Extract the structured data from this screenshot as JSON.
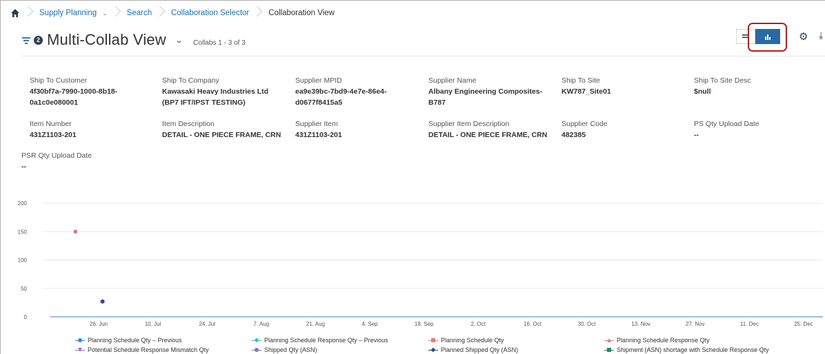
{
  "breadcrumb": {
    "items": [
      {
        "label": "Supply Planning",
        "link": true
      },
      {
        "label": "Search",
        "link": true
      },
      {
        "label": "Collaboration Selector",
        "link": true
      },
      {
        "label": "Collaboration View",
        "link": false
      }
    ]
  },
  "header": {
    "filter_badge": "2",
    "title": "Multi-Collab View",
    "collabs_count": "Collabs 1 - 3 of 3"
  },
  "details": [
    {
      "label": "Ship To Customer",
      "value": "4f30bf7a-7990-1000-8b18-0a1c0e080001"
    },
    {
      "label": "Ship To Company",
      "value": "Kawasaki Heavy Industries Ltd (BP7 IFT/IPST TESTING)"
    },
    {
      "label": "Supplier MPID",
      "value": "ea9e39bc-7bd9-4e7e-86e4-d0677f8415a5"
    },
    {
      "label": "Supplier Name",
      "value": "Albany Engineering Composites-B787"
    },
    {
      "label": "Ship To Site",
      "value": "KW787_Site01"
    },
    {
      "label": "Ship To Site Desc",
      "value": "$null"
    },
    {
      "label": "Item Number",
      "value": "431Z1103-201"
    },
    {
      "label": "Item Description",
      "value": "DETAIL - ONE PIECE FRAME, CRN"
    },
    {
      "label": "Supplier Item",
      "value": "431Z1103-201"
    },
    {
      "label": "Supplier Item Description",
      "value": "DETAIL - ONE PIECE FRAME, CRN"
    },
    {
      "label": "Supplier Code",
      "value": "482385"
    },
    {
      "label": "PS Qty Upload Date",
      "value": "--"
    },
    {
      "label": "PSR Qty Upload Date",
      "value": "--"
    }
  ],
  "chart_data": {
    "type": "scatter",
    "y_ticks": [
      "0",
      "50",
      "100",
      "150",
      "200"
    ],
    "ylim": [
      0,
      200
    ],
    "x_ticks": [
      "26. Jun",
      "10. Jul",
      "24. Jul",
      "7. Aug",
      "21. Aug",
      "4. Sep",
      "18. Sep",
      "2. Oct",
      "16. Oct",
      "30. Oct",
      "13. Nov",
      "27. Nov",
      "11. Dec",
      "25. Dec"
    ],
    "points": [
      {
        "series": "Planning Schedule Qty",
        "x": "20. Jun",
        "y": 150
      },
      {
        "series": "Potential Schedule Response Mismatch Qty",
        "x": "20. Jun",
        "y": 150
      },
      {
        "series": "Shipped Qty (ASN)",
        "x": "27. Jun",
        "y": 27
      }
    ],
    "series": [
      {
        "name": "Planning Schedule Qty – Previous",
        "color": "#2f8fd8",
        "marker": "circle"
      },
      {
        "name": "Planning Schedule Response Qty – Previous",
        "color": "#3ec4a8",
        "marker": "diamond"
      },
      {
        "name": "Planning Schedule Qty",
        "color": "#f47a70",
        "marker": "square"
      },
      {
        "name": "Planning Schedule Response Qty",
        "color": "#c48a7a",
        "marker": "triangle"
      },
      {
        "name": "Potential Schedule Response Mismatch Qty",
        "color": "#9b6fd0",
        "marker": "triangle-down"
      },
      {
        "name": "Shipped Qty (ASN)",
        "color": "#7a7ab8",
        "marker": "circle"
      },
      {
        "name": "Planned Shipped Qty (ASN)",
        "color": "#2a4f6e",
        "marker": "diamond"
      },
      {
        "name": "Shipment (ASN) shortage with Schedule Response Qty",
        "color": "#1f8a6a",
        "marker": "square"
      }
    ],
    "shipped_point_color": "#4a3aa0",
    "grid": true,
    "legend_position": "bottom"
  }
}
